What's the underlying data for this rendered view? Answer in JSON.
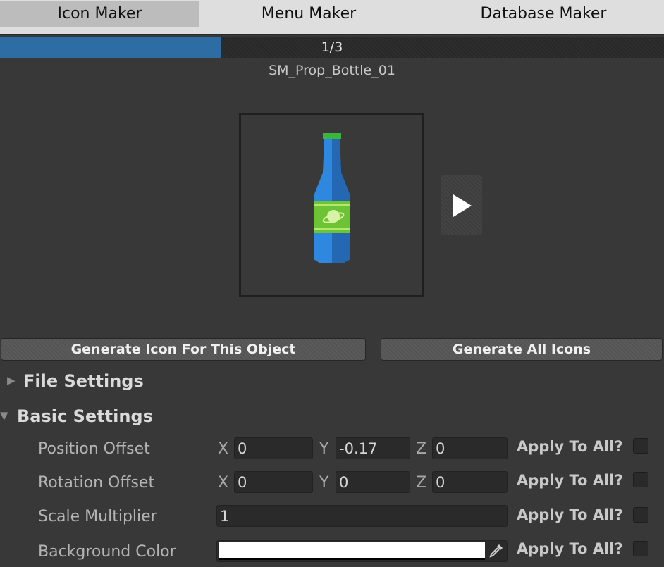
{
  "tabs": [
    {
      "label": "Icon Maker",
      "active": true
    },
    {
      "label": "Menu Maker",
      "active": false
    },
    {
      "label": "Database Maker",
      "active": false
    }
  ],
  "progress": {
    "text": "1/3",
    "fraction": 0.333,
    "color": "#2d6da3"
  },
  "object_name": "SM_Prop_Bottle_01",
  "preview": {
    "icon": "bottle-preview-icon",
    "next_icon": "play-arrow-icon"
  },
  "buttons": {
    "generate_this": "Generate Icon For This Object",
    "generate_all": "Generate All Icons"
  },
  "sections": {
    "file_settings": "File Settings",
    "basic_settings": "Basic Settings"
  },
  "axes": {
    "x": "X",
    "y": "Y",
    "z": "Z"
  },
  "rows": {
    "position": {
      "label": "Position Offset",
      "x": "0",
      "y": "-0.17",
      "z": "0",
      "apply": "Apply To All?",
      "apply_checked": false
    },
    "rotation": {
      "label": "Rotation Offset",
      "x": "0",
      "y": "0",
      "z": "0",
      "apply": "Apply To All?",
      "apply_checked": false
    },
    "scale": {
      "label": "Scale Multiplier",
      "value": "1",
      "apply": "Apply To All?",
      "apply_checked": false
    },
    "background": {
      "label": "Background Color",
      "color": "#ffffff",
      "apply": "Apply To All?",
      "apply_checked": false
    }
  }
}
